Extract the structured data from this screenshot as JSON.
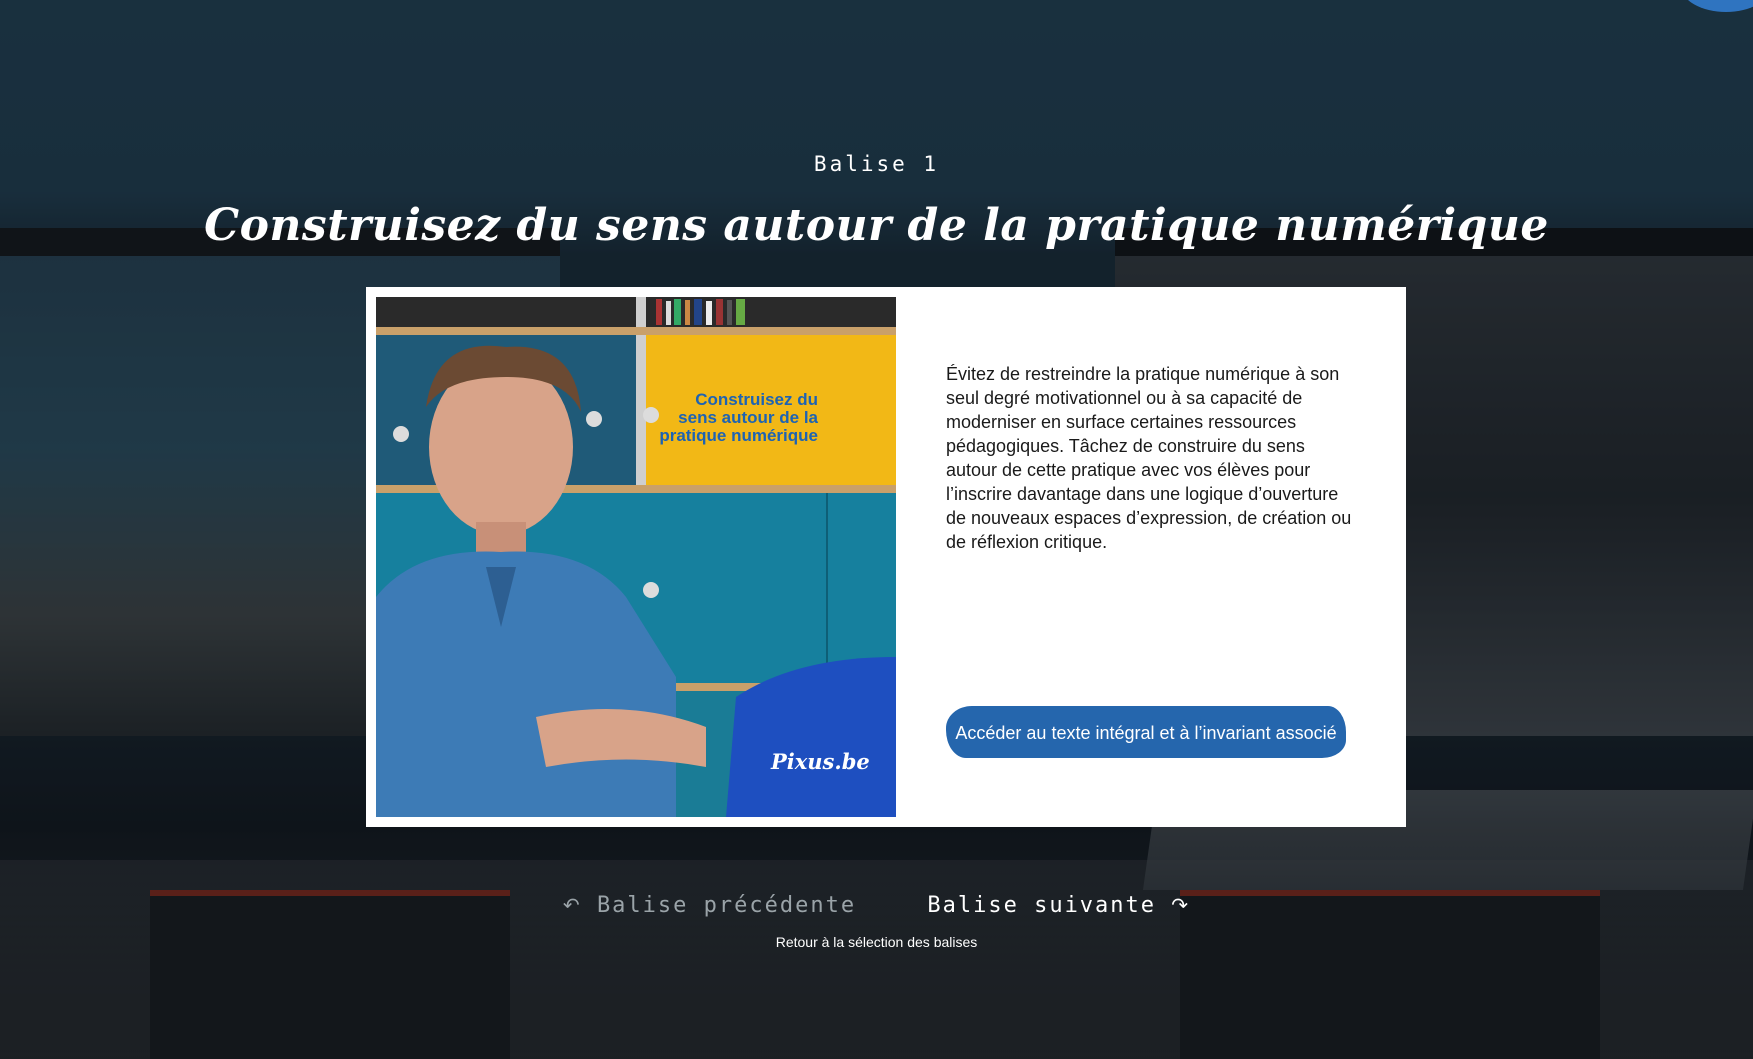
{
  "header": {
    "kicker": "Balise 1",
    "title": "Construisez du sens autour de la pratique numérique"
  },
  "card": {
    "video": {
      "overlay_title_line1": "Construisez du",
      "overlay_title_line2": "sens autour de la",
      "overlay_title_line3": "pratique numérique",
      "watermark": "Pixus.be"
    },
    "body": "Évitez de restreindre la pratique numérique à son seul degré motivationnel ou à sa capacité de moderniser en surface certaines ressources pédagogiques. Tâchez de construire du sens autour de cette pratique avec vos élèves pour l’inscrire davantage dans une logique d’ouverture de nouveaux espaces d’expression, de création ou de réflexion critique.",
    "cta_label": "Accéder au texte intégral et à l’invariant associé"
  },
  "nav": {
    "prev_label": "Balise précédente",
    "next_label": "Balise suivante",
    "prev_icon": "↶",
    "next_icon": "↷",
    "back_label": "Retour à la sélection des balises"
  },
  "colors": {
    "accent": "#2566ad",
    "text_light": "#ffffff",
    "muted": "#9aa3a8"
  }
}
